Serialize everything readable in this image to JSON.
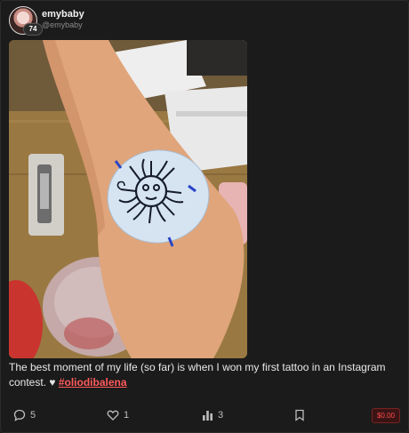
{
  "post": {
    "author": {
      "name": "emybaby",
      "handle": "@emybaby",
      "level": "74"
    },
    "caption": {
      "text": "The best moment of my life (so far) is when I won my first tattoo in an Instagram contest.",
      "emoji": "♥",
      "hashtag": "#oliodibalena"
    },
    "actions": {
      "comments": "5",
      "likes": "1",
      "views": "3",
      "price": "$0.00"
    },
    "icons": {
      "comments": "speech-bubble-icon",
      "likes": "heart-icon",
      "views": "bar-chart-icon",
      "bookmark": "bookmark-icon"
    },
    "colors": {
      "accent": "#ff4d4d",
      "hashtag": "#ff5a5a",
      "background": "#1b1b1b"
    }
  }
}
